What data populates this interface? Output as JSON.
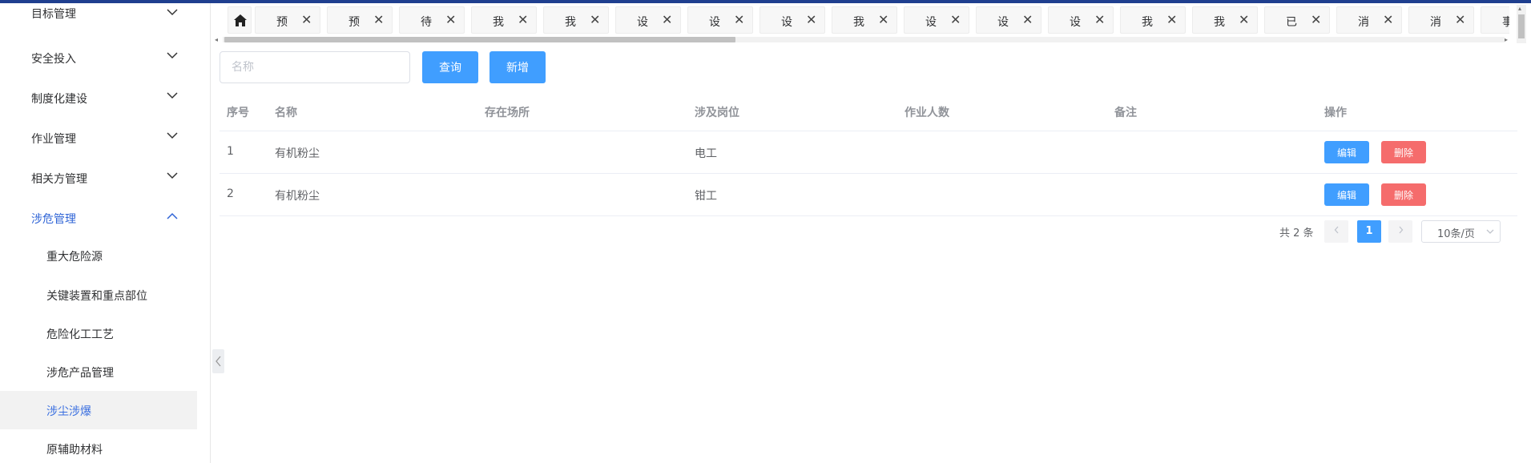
{
  "sidebar": {
    "items": [
      {
        "label": "目标管理"
      },
      {
        "label": "安全投入"
      },
      {
        "label": "制度化建设"
      },
      {
        "label": "作业管理"
      },
      {
        "label": "相关方管理"
      },
      {
        "label": "涉危管理"
      }
    ],
    "sub_items": [
      {
        "label": "重大危险源"
      },
      {
        "label": "关键装置和重点部位"
      },
      {
        "label": "危险化工工艺"
      },
      {
        "label": "涉危产品管理"
      },
      {
        "label": "涉尘涉爆"
      },
      {
        "label": "原辅助材料"
      }
    ]
  },
  "tabs": [
    "预",
    "预",
    "待",
    "我",
    "我",
    "设",
    "设",
    "设",
    "我",
    "设",
    "设",
    "设",
    "我",
    "我",
    "已",
    "消",
    "消",
    "事"
  ],
  "toolbar": {
    "name_placeholder": "名称",
    "query_label": "查询",
    "add_label": "新增"
  },
  "table": {
    "columns": [
      "序号",
      "名称",
      "存在场所",
      "涉及岗位",
      "作业人数",
      "备注",
      "操作"
    ],
    "rows": [
      {
        "index": "1",
        "name": "有机粉尘",
        "place": "",
        "post": "电工",
        "workers": "",
        "note": ""
      },
      {
        "index": "2",
        "name": "有机粉尘",
        "place": "",
        "post": "钳工",
        "workers": "",
        "note": ""
      }
    ],
    "edit_label": "编辑",
    "delete_label": "删除"
  },
  "pagination": {
    "total_text": "共 2 条",
    "current_page": "1",
    "page_size": "10条/页"
  },
  "colors": {
    "primary": "#409eff",
    "danger": "#f56c6c",
    "active_menu": "#2f64d6",
    "topbar": "#1f3f8f"
  }
}
